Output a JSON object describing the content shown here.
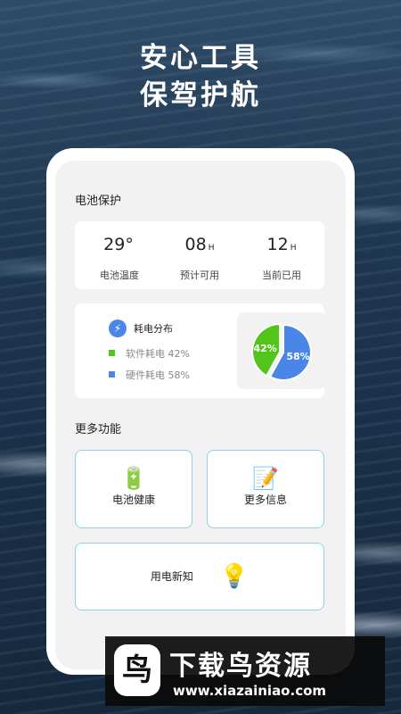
{
  "hero": {
    "line1": "安心工具",
    "line2": "保驾护航"
  },
  "battery_protection": {
    "title": "电池保护",
    "stats": [
      {
        "value": "29°",
        "unit": "",
        "label": "电池温度"
      },
      {
        "value": "08",
        "unit": "H",
        "label": "预计可用"
      },
      {
        "value": "12",
        "unit": "H",
        "label": "当前已用"
      }
    ]
  },
  "distribution": {
    "title": "耗电分布",
    "legend": [
      {
        "label": "软件耗电 42%",
        "color": "#52c41a"
      },
      {
        "label": "硬件耗电 58%",
        "color": "#4a86e8"
      }
    ]
  },
  "chart_data": {
    "type": "pie",
    "slices": [
      {
        "label": "42%",
        "value": 42,
        "color": "#52c41a"
      },
      {
        "label": "58%",
        "value": 58,
        "color": "#4a86e8"
      }
    ]
  },
  "more": {
    "title": "更多功能",
    "battery_health": "电池健康",
    "more_info": "更多信息",
    "power_tips": "用电新知"
  },
  "watermark": {
    "brand": "下载鸟资源",
    "url": "www.xiazainiao.com",
    "logo_glyph": "鸟"
  },
  "colors": {
    "accent": "#4a86e8",
    "green": "#52c41a",
    "border": "#8fd0e6"
  }
}
